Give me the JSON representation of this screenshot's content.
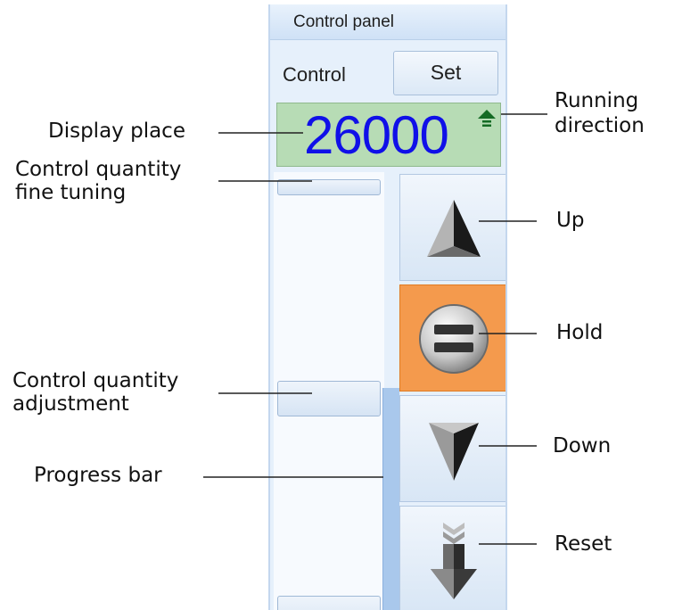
{
  "panel": {
    "title": "Control panel",
    "control_label": "Control",
    "set_label": "Set",
    "display_value": "26000",
    "direction_icon": "up-arrow-icon",
    "progress_fraction": 0.5
  },
  "buttons": {
    "up_icon": "up-triangle-icon",
    "hold_icon": "pause-equals-icon",
    "down_icon": "down-triangle-icon",
    "reset_icon": "down-arrow-icon"
  },
  "callouts": {
    "display_place": "Display place",
    "fine_tuning_line1": "Control quantity",
    "fine_tuning_line2": "fine tuning",
    "adjustment_line1": "Control quantity",
    "adjustment_line2": "adjustment",
    "progress_bar": "Progress bar",
    "running_line1": "Running",
    "running_line2": "direction",
    "up": "Up",
    "hold": "Hold",
    "down": "Down",
    "reset": "Reset"
  },
  "colors": {
    "display_bg": "#b7dcb5",
    "display_text": "#1010e8",
    "hold_bg": "#f49a4d",
    "direction_arrow": "#146b24"
  }
}
